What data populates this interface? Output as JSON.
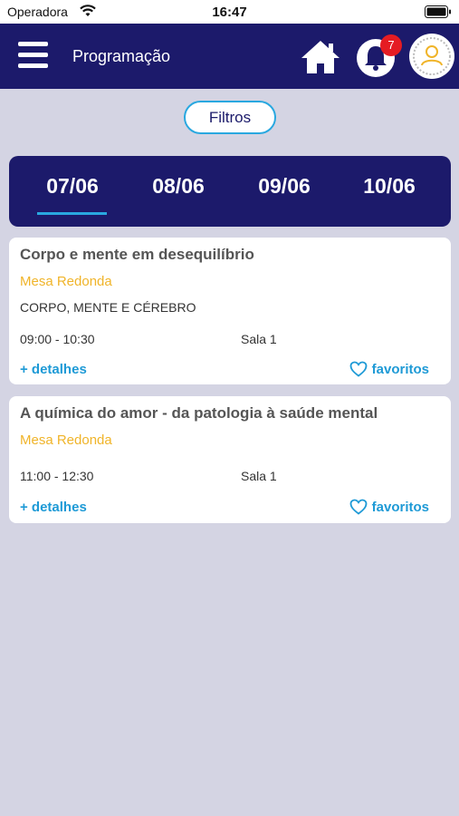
{
  "status": {
    "carrier": "Operadora",
    "time": "16:47"
  },
  "header": {
    "title": "Programação",
    "notifications_count": "7"
  },
  "filters_label": "Filtros",
  "date_tabs": [
    {
      "label": "07/06",
      "selected": true
    },
    {
      "label": "08/06",
      "selected": false
    },
    {
      "label": "09/06",
      "selected": false
    },
    {
      "label": "10/06",
      "selected": false
    }
  ],
  "sessions": [
    {
      "title": "Corpo e mente em desequilíbrio",
      "type": "Mesa Redonda",
      "theme": "CORPO, MENTE E CÉREBRO",
      "time": "09:00 - 10:30",
      "room": "Sala 1",
      "details_label": "+ detalhes",
      "favorite_label": "favoritos"
    },
    {
      "title": "A química do amor - da patologia à saúde mental",
      "type": "Mesa Redonda",
      "time": "11:00 - 12:30",
      "room": "Sala 1",
      "details_label": "+ detalhes",
      "favorite_label": "favoritos"
    }
  ],
  "colors": {
    "navy": "#1c1a6b",
    "accent_blue": "#1e9ad6",
    "type_yellow": "#f0b429",
    "background": "#d4d4e3",
    "badge_red": "#e51c23"
  },
  "icons": {
    "menu": "hamburger-icon",
    "home": "home-icon",
    "notifications": "bell-icon",
    "profile": "user-icon",
    "favorite": "heart-icon"
  }
}
